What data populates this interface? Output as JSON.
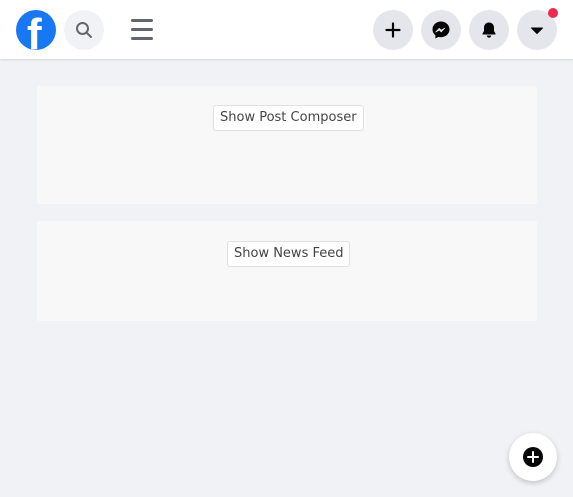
{
  "header": {
    "logo_letter": "f",
    "brand_color": "#1877f2",
    "icons": {
      "logo": "facebook-logo",
      "search": "search-icon",
      "menu": "hamburger-menu-icon",
      "create": "plus-icon",
      "messenger": "messenger-icon",
      "notifications": "bell-icon",
      "account": "caret-down-icon"
    },
    "notification_badge_color": "#f02849"
  },
  "main": {
    "post_composer_button": "Show Post Composer",
    "news_feed_button": "Show News Feed"
  },
  "fab": {
    "icon": "compose-plus-icon"
  }
}
